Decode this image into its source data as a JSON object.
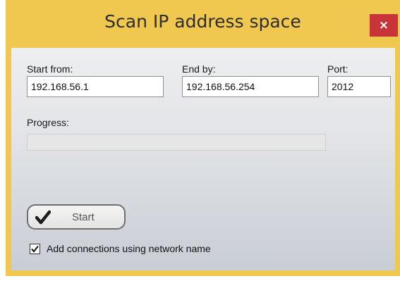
{
  "window": {
    "title": "Scan IP address space",
    "close_label": "×"
  },
  "form": {
    "start_label": "Start from:",
    "start_value": "192.168.56.1",
    "end_label": "End by:",
    "end_value": "192.168.56.254",
    "port_label": "Port:",
    "port_value": "2012",
    "progress_label": "Progress:",
    "progress_value": 0
  },
  "actions": {
    "start_label": "Start",
    "start_icon": "checkmark-icon"
  },
  "options": {
    "add_connections_label": "Add connections using network name",
    "add_connections_checked": true
  },
  "colors": {
    "titlebar": "#f0c84f",
    "close_button": "#c9343a"
  }
}
